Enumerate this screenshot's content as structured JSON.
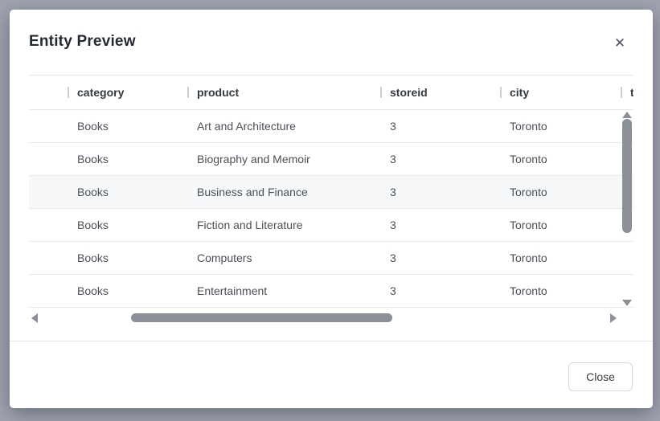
{
  "modal": {
    "title": "Entity Preview",
    "close_icon": "✕",
    "footer": {
      "close_label": "Close"
    }
  },
  "table": {
    "columns": [
      {
        "label": "category"
      },
      {
        "label": "product"
      },
      {
        "label": "storeid"
      },
      {
        "label": "city"
      },
      {
        "label": "t"
      }
    ],
    "rows": [
      {
        "category": "Books",
        "product": "Art and Architecture",
        "storeid": "3",
        "city": "Toronto"
      },
      {
        "category": "Books",
        "product": "Biography and Memoir",
        "storeid": "3",
        "city": "Toronto"
      },
      {
        "category": "Books",
        "product": "Business and Finance",
        "storeid": "3",
        "city": "Toronto"
      },
      {
        "category": "Books",
        "product": "Fiction and Literature",
        "storeid": "3",
        "city": "Toronto"
      },
      {
        "category": "Books",
        "product": "Computers",
        "storeid": "3",
        "city": "Toronto"
      },
      {
        "category": "Books",
        "product": "Entertainment",
        "storeid": "3",
        "city": "Toronto"
      }
    ],
    "highlighted_row_index": 2
  },
  "colors": {
    "overlay": "#a0a4b1",
    "modal_background": "#ffffff",
    "row_highlight": "#f7f8fa",
    "scrollbar": "#8b8f97",
    "border": "#e4e6ea"
  }
}
